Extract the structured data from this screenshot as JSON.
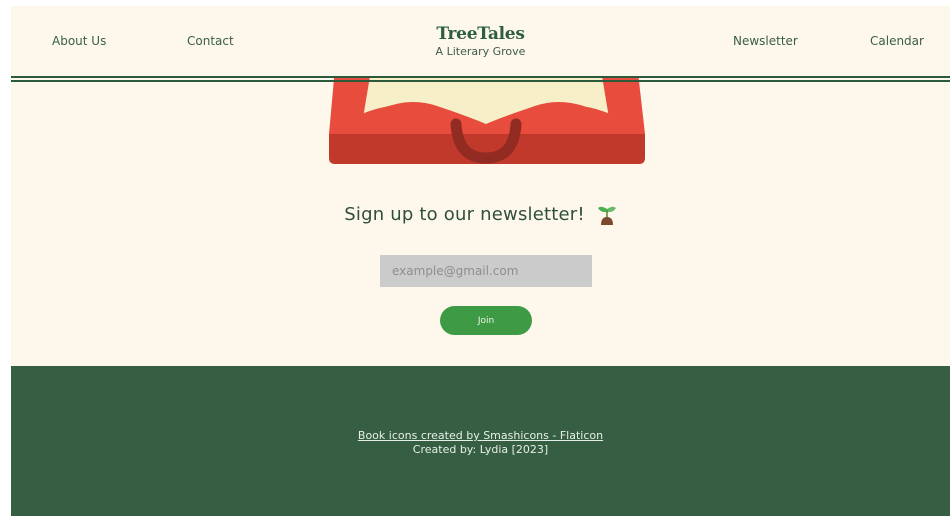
{
  "nav": {
    "about": "About Us",
    "contact": "Contact",
    "newsletter": "Newsletter",
    "calendar": "Calendar"
  },
  "brand": {
    "title": "TreeTales",
    "subtitle": "A Literary Grove"
  },
  "newsletter": {
    "heading": "Sign up to our newsletter!",
    "icon": "sprout-icon",
    "email_placeholder": "example@gmail.com",
    "join_label": "Join"
  },
  "footer": {
    "credit_link": "Book icons created by Smashicons - Flaticon",
    "created_by": "Created by: Lydia [2023]"
  },
  "colors": {
    "background": "#fef8ec",
    "brand_green": "#2e5e3f",
    "footer_green": "#365e42",
    "button_green": "#3f9a45",
    "input_gray": "#cbcbcb",
    "book_red": "#e74c3c",
    "book_dark_red": "#c0392b",
    "page_cream": "#f6efc8"
  }
}
